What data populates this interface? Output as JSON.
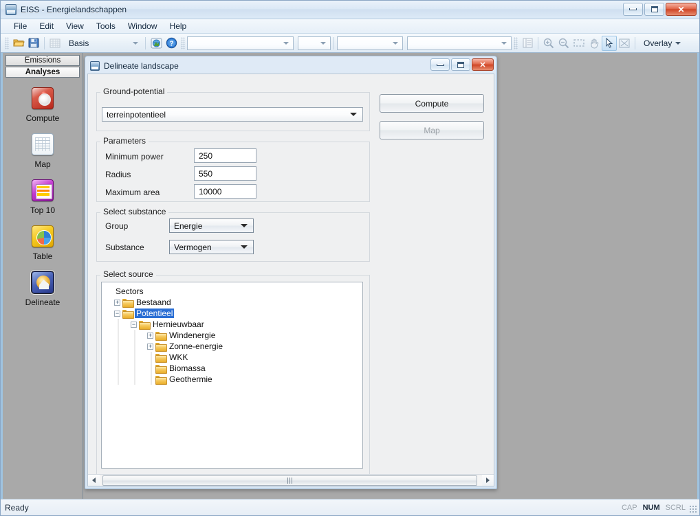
{
  "window": {
    "title": "EISS - Energielandschappen",
    "app_icon": "eiss-app-icon",
    "minimize_label": "",
    "maximize_label": "",
    "close_label": "✕"
  },
  "menu": {
    "items": [
      {
        "label": "File"
      },
      {
        "label": "Edit"
      },
      {
        "label": "View"
      },
      {
        "label": "Tools"
      },
      {
        "label": "Window"
      },
      {
        "label": "Help"
      }
    ]
  },
  "toolbar": {
    "open_icon": "open-folder-icon",
    "save_icon": "save-disk-icon",
    "grid_icon": "grid-icon",
    "basis_combo_value": "Basis",
    "globe_icon": "globe-icon",
    "help_icon": "help-question-icon",
    "combo1_value": "",
    "combo2_value": "",
    "combo3_value": "",
    "combo4_value": "",
    "legend_icon": "legend-icon",
    "zoom_in_icon": "zoom-in-icon",
    "zoom_out_icon": "zoom-out-icon",
    "zoom_rect_icon": "zoom-rectangle-icon",
    "pan_icon": "pan-hand-icon",
    "select_icon": "select-arrow-icon",
    "fit_icon": "fit-extent-icon",
    "overlay_label": "Overlay"
  },
  "sidebar": {
    "tabs": [
      {
        "label": "Emissions",
        "selected": false
      },
      {
        "label": "Analyses",
        "selected": true
      }
    ],
    "items": [
      {
        "label": "Compute",
        "icon": "compute-icon",
        "selected": false
      },
      {
        "label": "Map",
        "icon": "map-icon",
        "selected": false
      },
      {
        "label": "Top 10",
        "icon": "top10-icon",
        "selected": false
      },
      {
        "label": "Table",
        "icon": "table-icon",
        "selected": false
      },
      {
        "label": "Delineate",
        "icon": "delineate-icon",
        "selected": true
      }
    ]
  },
  "dialog": {
    "title": "Delineate landscape",
    "icon": "delineate-window-icon",
    "minimize_label": "",
    "maximize_label": "",
    "close_label": "✕",
    "ground_potential": {
      "group_title": "Ground-potential",
      "combo_value": "terreinpotentieel"
    },
    "parameters": {
      "group_title": "Parameters",
      "fields": [
        {
          "label": "Minimum power",
          "value": "250"
        },
        {
          "label": "Radius",
          "value": "550"
        },
        {
          "label": "Maximum area",
          "value": "10000"
        }
      ]
    },
    "select_substance": {
      "group_title": "Select substance",
      "group": {
        "label": "Group",
        "value": "Energie"
      },
      "substance": {
        "label": "Substance",
        "value": "Vermogen"
      }
    },
    "select_source": {
      "group_title": "Select source",
      "tree": {
        "root_label": "Sectors",
        "nodes": [
          {
            "label": "Bestaand",
            "depth": 1,
            "expander": "+",
            "selected": false
          },
          {
            "label": "Potentieel",
            "depth": 1,
            "expander": "−",
            "selected": true
          },
          {
            "label": "Hernieuwbaar",
            "depth": 2,
            "expander": "−",
            "selected": false
          },
          {
            "label": "Windenergie",
            "depth": 3,
            "expander": "+",
            "selected": false
          },
          {
            "label": "Zonne-energie",
            "depth": 3,
            "expander": "+",
            "selected": false
          },
          {
            "label": "WKK",
            "depth": 3,
            "expander": "",
            "selected": false
          },
          {
            "label": "Biomassa",
            "depth": 3,
            "expander": "",
            "selected": false
          },
          {
            "label": "Geothermie",
            "depth": 3,
            "expander": "",
            "selected": false
          }
        ]
      }
    },
    "actions": {
      "compute_label": "Compute",
      "map_label": "Map"
    }
  },
  "statusbar": {
    "message": "Ready",
    "indicators": [
      {
        "label": "CAP",
        "active": false
      },
      {
        "label": "NUM",
        "active": true
      },
      {
        "label": "SCRL",
        "active": false
      }
    ]
  },
  "colors": {
    "selection_blue": "#2a6ed4",
    "close_red": "#cf4526",
    "mdi_background": "#a9a9a9",
    "accent_border": "#9fc3e0"
  }
}
